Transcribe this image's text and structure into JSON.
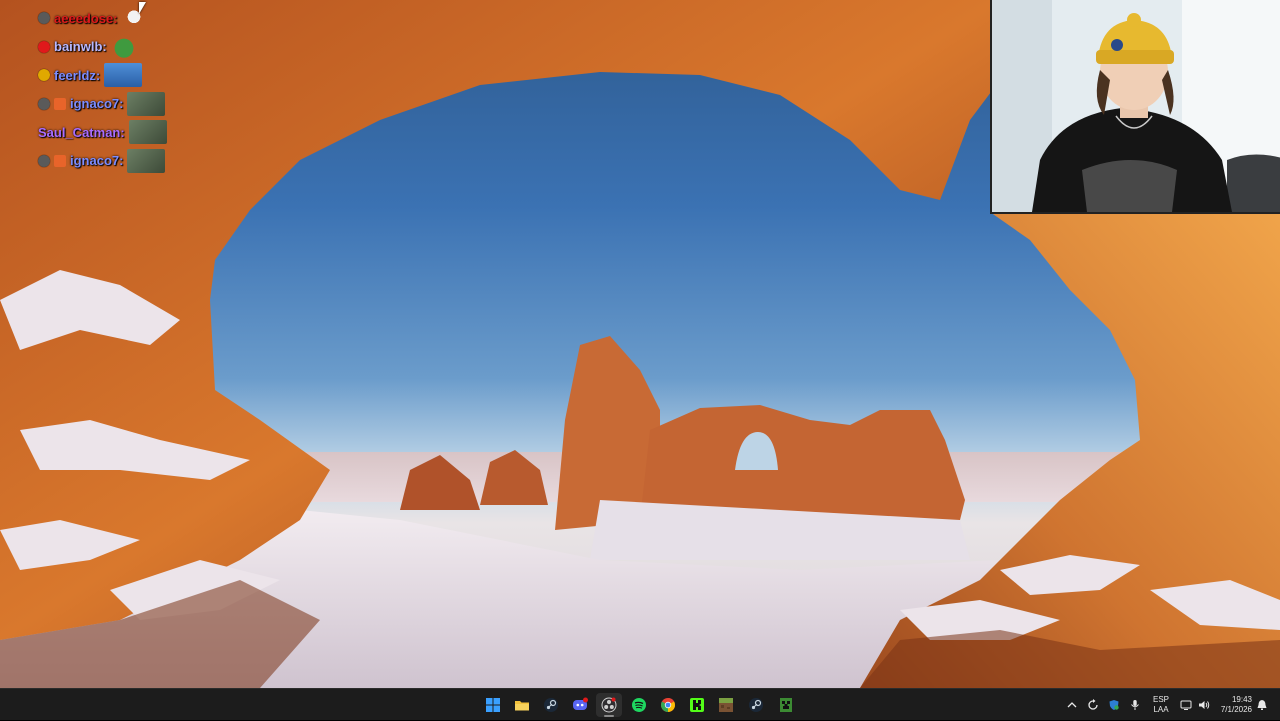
{
  "chat": {
    "messages": [
      {
        "username": "aeeedose:",
        "color": "#e0191b",
        "badge_color": "#5a5a5a",
        "badge2_color": null,
        "emote_color": "#d6d6d6"
      },
      {
        "username": "bainwlb:",
        "color": "#b8b8ff",
        "badge_color": "#e0191b",
        "badge2_color": null,
        "emote_color": "#3f9a3f"
      },
      {
        "username": "feerldz:",
        "color": "#7b8cff",
        "badge_color": "#e0a800",
        "badge2_color": null,
        "emote_color": "#4f8fd8"
      },
      {
        "username": "ignaco7:",
        "color": "#7b8cff",
        "badge_color": "#5a5a5a",
        "badge2_color": "#e8642a",
        "emote_color": "#6c7f64"
      },
      {
        "username": "Saul_Catman:",
        "color": "#a86cff",
        "badge_color": null,
        "badge2_color": null,
        "emote_color": "#6c7f64"
      },
      {
        "username": "ignaco7:",
        "color": "#7b8cff",
        "badge_color": "#5a5a5a",
        "badge2_color": "#e8642a",
        "emote_color": "#6c7f64"
      }
    ]
  },
  "taskbar": {
    "apps": [
      {
        "name": "start-button",
        "icon": "windows-logo-icon",
        "color": "#3aa0ff",
        "active": false
      },
      {
        "name": "file-explorer",
        "icon": "folder-icon",
        "color": "#f2c13b",
        "active": false
      },
      {
        "name": "steam",
        "icon": "steam-icon",
        "color": "#c7d5e0",
        "active": false
      },
      {
        "name": "discord",
        "icon": "discord-icon",
        "color": "#5865f2",
        "active": false
      },
      {
        "name": "obs",
        "icon": "obs-icon",
        "color": "#d0d0d0",
        "active": true
      },
      {
        "name": "spotify",
        "icon": "spotify-icon",
        "color": "#1ed760",
        "active": false
      },
      {
        "name": "chrome",
        "icon": "chrome-icon",
        "color": "#e94235",
        "active": false
      },
      {
        "name": "kick",
        "icon": "kick-icon",
        "color": "#53fc18",
        "active": false
      },
      {
        "name": "minecraft",
        "icon": "minecraft-icon",
        "color": "#7ba142",
        "active": false
      },
      {
        "name": "steam-2",
        "icon": "steam-icon",
        "color": "#c7d5e0",
        "active": false
      },
      {
        "name": "minecraft-launcher",
        "icon": "creeper-icon",
        "color": "#3c8b33",
        "active": false
      }
    ],
    "tray": {
      "language_line1": "ESP",
      "language_line2": "LAA",
      "time": "19:43",
      "date": "7/1/2026"
    }
  }
}
